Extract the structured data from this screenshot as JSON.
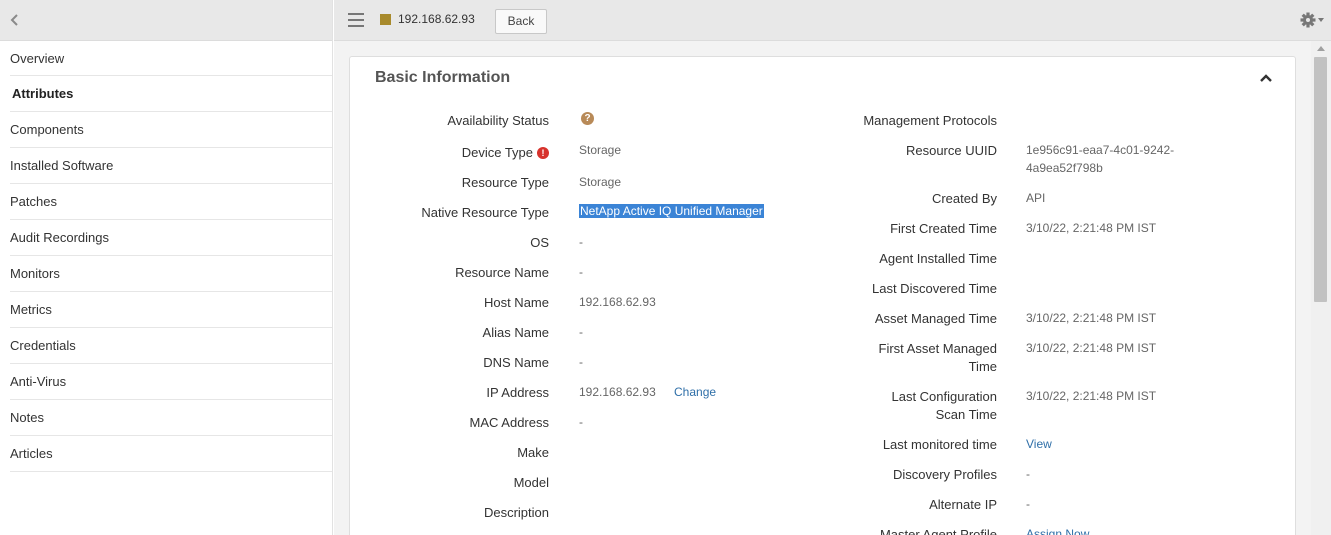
{
  "sidebar": {
    "items": [
      {
        "label": "Overview",
        "active": false
      },
      {
        "label": "Attributes",
        "active": true
      },
      {
        "label": "Components",
        "active": false
      },
      {
        "label": "Installed Software",
        "active": false
      },
      {
        "label": "Patches",
        "active": false
      },
      {
        "label": "Audit Recordings",
        "active": false
      },
      {
        "label": "Monitors",
        "active": false
      },
      {
        "label": "Metrics",
        "active": false
      },
      {
        "label": "Credentials",
        "active": false
      },
      {
        "label": "Anti-Virus",
        "active": false
      },
      {
        "label": "Notes",
        "active": false
      },
      {
        "label": "Articles",
        "active": false
      }
    ]
  },
  "topbar": {
    "device_ip": "192.168.62.93",
    "device_color": "#a88a2c",
    "back_label": "Back",
    "icons": [
      "chevron-left-icon",
      "hamburger-menu-icon",
      "gear-icon",
      "caret-down-icon"
    ]
  },
  "panel": {
    "title": "Basic Information",
    "left_fields": [
      {
        "label": "Availability Status",
        "value": ""
      },
      {
        "label": "Device Type",
        "value": "Storage"
      },
      {
        "label": "Resource Type",
        "value": "Storage"
      },
      {
        "label": "Native Resource Type",
        "value": "NetApp Active IQ Unified Manager"
      },
      {
        "label": "OS",
        "value": "-"
      },
      {
        "label": "Resource Name",
        "value": "-"
      },
      {
        "label": "Host Name",
        "value": "192.168.62.93"
      },
      {
        "label": "Alias Name",
        "value": "-"
      },
      {
        "label": "DNS Name",
        "value": "-"
      },
      {
        "label": "IP Address",
        "value": "192.168.62.93",
        "link": "Change"
      },
      {
        "label": "MAC Address",
        "value": "-"
      },
      {
        "label": "Make",
        "value": ""
      },
      {
        "label": "Model",
        "value": ""
      },
      {
        "label": "Description",
        "value": ""
      }
    ],
    "right_fields": [
      {
        "label": "Management Protocols",
        "value": ""
      },
      {
        "label": "Resource UUID",
        "value_line1": "1e956c91-eaa7-4c01-9242-",
        "value_line2": "4a9ea52f798b"
      },
      {
        "label": "Created By",
        "value": "API"
      },
      {
        "label": "First Created Time",
        "value": "3/10/22, 2:21:48 PM IST"
      },
      {
        "label": "Agent Installed Time",
        "value": ""
      },
      {
        "label": "Last Discovered Time",
        "value": ""
      },
      {
        "label": "Asset Managed Time",
        "value": "3/10/22, 2:21:48 PM IST"
      },
      {
        "label_line1": "First Asset Managed",
        "label_line2": "Time",
        "value": "3/10/22, 2:21:48 PM IST"
      },
      {
        "label_line1": "Last Configuration",
        "label_line2": "Scan Time",
        "value": "3/10/22, 2:21:48 PM IST"
      },
      {
        "label": "Last monitored time",
        "link": "View"
      },
      {
        "label": "Discovery Profiles",
        "value": "-"
      },
      {
        "label": "Alternate IP",
        "value": "-"
      },
      {
        "label": "Master Agent Profile",
        "link": "Assign Now"
      }
    ]
  },
  "colors": {
    "link": "#2f6fa8",
    "selection": "#3b84d6",
    "status_unknown": "#b88a58",
    "error": "#d7322c"
  }
}
